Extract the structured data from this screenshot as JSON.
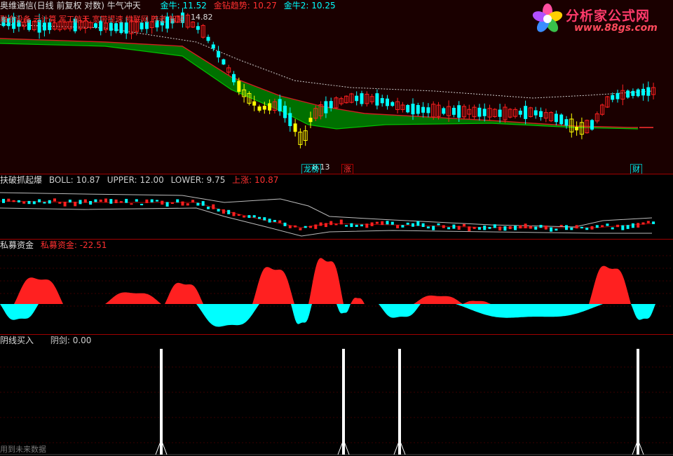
{
  "main_header": {
    "title": "奥维通信(日线 前复权 对数) 牛气冲天",
    "items": [
      {
        "label": "金牛:",
        "value": "11.52",
        "color": "#00ffff"
      },
      {
        "label": "金钻趋势:",
        "value": "10.27",
        "color": "#ff3030"
      },
      {
        "label": "金牛2:",
        "value": "10.25",
        "color": "#00ffff"
      }
    ]
  },
  "concept_text": "融合设备 云计算 军工航天 宽带提速 物联网 养老 智慧",
  "price_high_label": "14.82",
  "price_low_label": "8.13",
  "signal_tags": [
    {
      "text": "龙榜",
      "color": "#00ffff"
    },
    {
      "text": "涨",
      "color": "#ff3030"
    },
    {
      "text": "财",
      "color": "#00ffff"
    }
  ],
  "logo": {
    "title": "分析家公式网",
    "url": "www.88gs.com"
  },
  "boll_header": {
    "title": "扶破抓起爆",
    "items": [
      {
        "label": "BOLL:",
        "value": "10.87",
        "color": "#cccccc"
      },
      {
        "label": "UPPER:",
        "value": "12.00",
        "color": "#cccccc"
      },
      {
        "label": "LOWER:",
        "value": "9.75",
        "color": "#cccccc"
      },
      {
        "label": "上涨:",
        "value": "10.87",
        "color": "#ff3030"
      }
    ]
  },
  "fund_header": {
    "title": "私募资金",
    "items": [
      {
        "label": "私募资金:",
        "value": "-22.51",
        "color": "#ff3030"
      }
    ]
  },
  "yang_header": {
    "title": "阴线买入",
    "items": [
      {
        "label": "阴剑:",
        "value": "0.00",
        "color": "#cccccc"
      }
    ]
  },
  "footnote": "用到未来数据",
  "colors": {
    "up": "#ff2020",
    "down": "#00ffff",
    "band": "#007000",
    "bg_main": "#1a0000",
    "separator": "#a00000"
  },
  "chart_data": [
    {
      "type": "candlestick",
      "title": "奥维通信(日线 前复权 对数) 牛气冲天",
      "series": [
        {
          "name": "金牛",
          "last": 11.52
        },
        {
          "name": "金钻趋势",
          "last": 10.27
        },
        {
          "name": "金牛2",
          "last": 10.25
        }
      ],
      "annotations": [
        "14.82",
        "8.13"
      ],
      "ylim": [
        8.13,
        14.82
      ]
    },
    {
      "type": "line",
      "title": "扶破抓起爆",
      "series": [
        {
          "name": "BOLL",
          "last": 10.87
        },
        {
          "name": "UPPER",
          "last": 12.0
        },
        {
          "name": "LOWER",
          "last": 9.75
        },
        {
          "name": "上涨",
          "last": 10.87
        }
      ]
    },
    {
      "type": "area",
      "title": "私募资金",
      "series": [
        {
          "name": "私募资金",
          "last": -22.51
        }
      ]
    },
    {
      "type": "bar",
      "title": "阴线买入",
      "series": [
        {
          "name": "阴剑",
          "last": 0.0
        }
      ]
    }
  ]
}
